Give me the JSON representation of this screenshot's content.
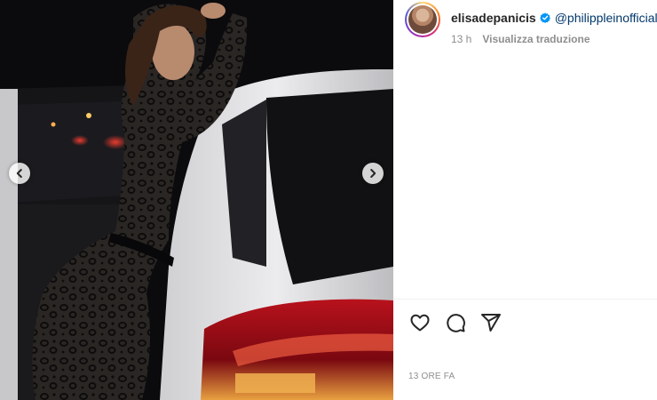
{
  "post": {
    "username": "elisadepanicis",
    "mention": "@philippleinofficial",
    "time": "13 h",
    "translate_label": "Visualizza traduzione",
    "date": "13 ORE FA"
  },
  "media": {
    "prev_icon": "chevron-left-icon",
    "next_icon": "chevron-right-icon"
  },
  "actions": [
    "heart-icon",
    "comment-icon",
    "share-icon"
  ],
  "colors": {
    "verified": "#0095f6",
    "mention": "#00376b",
    "muted": "#8e8e8e",
    "text": "#262626"
  }
}
